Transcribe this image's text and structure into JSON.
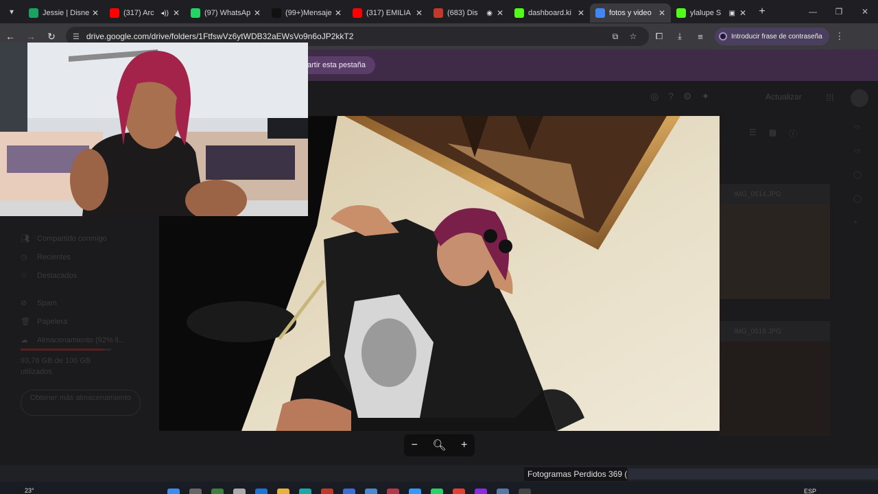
{
  "tabs": [
    {
      "title": "Jessie | Disne",
      "favicon_color": "#1aa260",
      "favicon_icon": "tab-favicon-icon",
      "active": false
    },
    {
      "title": "(317) Arc",
      "favicon_color": "#ff0000",
      "favicon_icon": "youtube-icon",
      "extra": "◂))",
      "active": false
    },
    {
      "title": "(97) WhatsAp",
      "favicon_color": "#25d366",
      "favicon_icon": "whatsapp-icon",
      "active": false
    },
    {
      "title": "(99+)Mensaje",
      "favicon_color": "#111111",
      "favicon_icon": "tiktok-icon",
      "active": false
    },
    {
      "title": "(317) EMILIA",
      "favicon_color": "#ff0000",
      "favicon_icon": "youtube-icon",
      "active": false
    },
    {
      "title": "(683) Dis",
      "favicon_color": "#c0392b",
      "favicon_icon": "tab-favicon-icon",
      "extra": "◉",
      "active": false
    },
    {
      "title": "dashboard.ki",
      "favicon_color": "#53fc18",
      "favicon_icon": "kick-icon",
      "active": false
    },
    {
      "title": "fotos y video",
      "favicon_color": "#4285f4",
      "favicon_icon": "google-drive-icon",
      "active": true
    },
    {
      "title": "ylalupe S",
      "favicon_color": "#53fc18",
      "favicon_icon": "kick-icon",
      "extra": "▣",
      "active": false
    }
  ],
  "toolbar": {
    "url": "drive.google.com/drive/folders/1FtfswVz6ytWDB32aEWsVo9n6oJP2kkT2",
    "password_chip": "Introducir frase de contraseña"
  },
  "sharebar": {
    "label": "artir esta pestaña"
  },
  "drive": {
    "header_action": "Actualizar",
    "nav": [
      {
        "label": "Compartido conmigo",
        "icon": "people-icon"
      },
      {
        "label": "Recientes",
        "icon": "clock-icon"
      },
      {
        "label": "Destacados",
        "icon": "star-icon"
      },
      {
        "label": "Spam",
        "icon": "spam-icon"
      },
      {
        "label": "Papelera",
        "icon": "trash-icon"
      },
      {
        "label": "Almacenamiento (92% li...",
        "icon": "cloud-icon"
      }
    ],
    "quota_text": "93,78 GB de 100 GB utilizados",
    "quota_fraction": 0.92,
    "quota_button": "Obtener más almacenamiento",
    "files": [
      {
        "name": "IMG_0514.JPG"
      },
      {
        "name": "IMG_0519.JPG"
      }
    ]
  },
  "obs": {
    "frames_text": "Fotogramas Perdidos 369 ("
  },
  "taskbar": {
    "temperature": "23°",
    "language": "ESP"
  },
  "colors": {
    "accent_share": "#5a3d69",
    "password_ring": "#a78bd0",
    "quota_bar": "#4b1e1e"
  }
}
